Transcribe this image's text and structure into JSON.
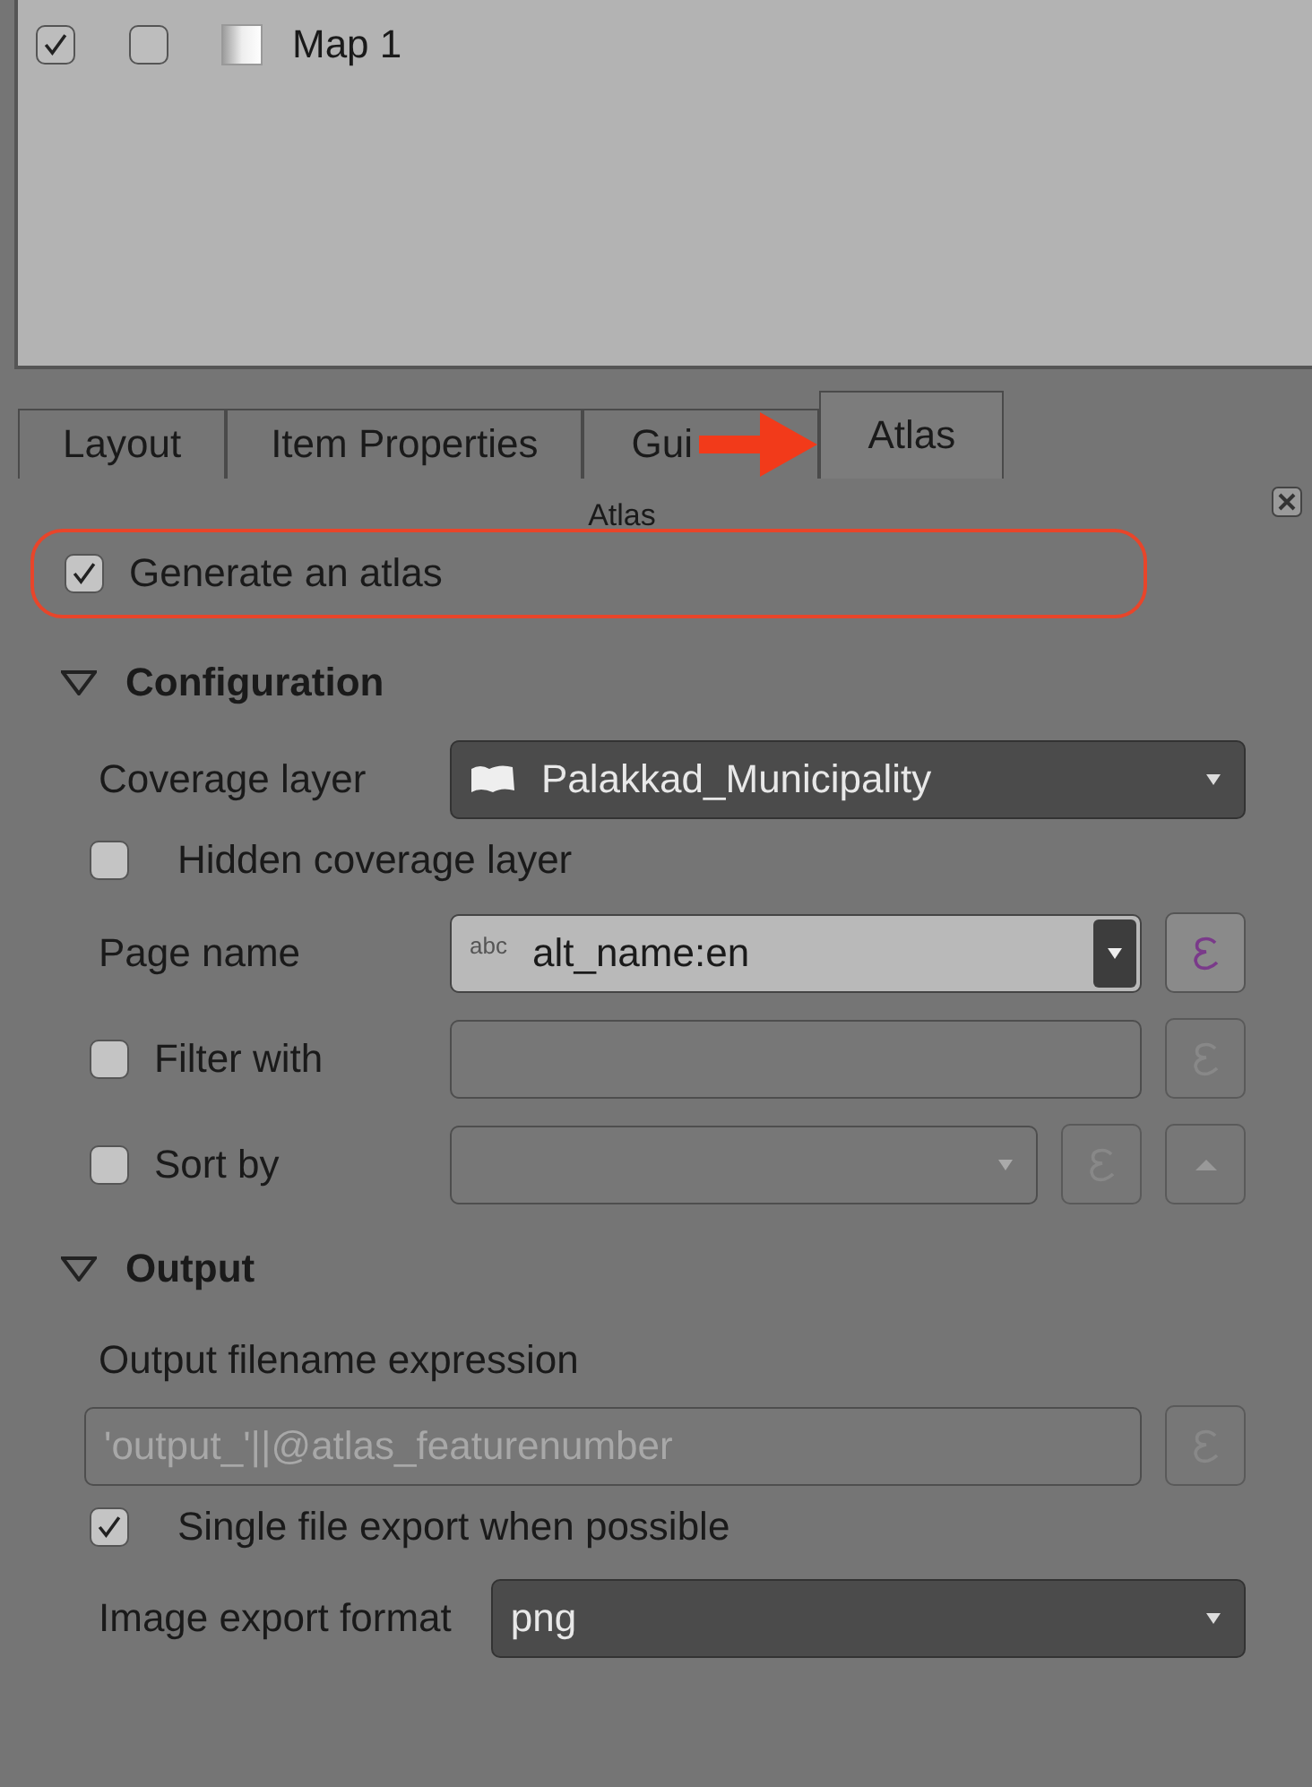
{
  "items_list": {
    "rows": [
      {
        "visible": true,
        "locked": false,
        "name": "Map 1"
      }
    ]
  },
  "tabs": [
    {
      "label": "Layout",
      "selected": false
    },
    {
      "label": "Item Properties",
      "selected": false
    },
    {
      "label": "Gui",
      "selected": false,
      "pointer_arrow": true
    },
    {
      "label": "Atlas",
      "selected": true
    }
  ],
  "panel": {
    "title": "Atlas"
  },
  "generate_atlas": {
    "label": "Generate an atlas",
    "checked": true,
    "highlighted": true
  },
  "sections": [
    {
      "title": "Configuration",
      "expanded": true,
      "rows": [
        {
          "kind": "layer-combo",
          "label": "Coverage layer",
          "value": "Palakkad_Municipality"
        },
        {
          "kind": "check",
          "label": "Hidden coverage layer",
          "checked": false
        },
        {
          "kind": "field-combo",
          "label": "Page name",
          "type_tag": "abc",
          "value": "alt_name:en",
          "expression_enabled": true
        },
        {
          "kind": "check-field",
          "label": "Filter with",
          "checked": false,
          "expression_enabled": false
        },
        {
          "kind": "check-combo",
          "label": "Sort by",
          "checked": false,
          "expression_enabled": false
        }
      ]
    },
    {
      "title": "Output",
      "expanded": true,
      "rows": [
        {
          "kind": "caption",
          "label": "Output filename expression"
        },
        {
          "kind": "expression-field",
          "value": "'output_'||@atlas_featurenumber",
          "disabled": true,
          "expression_enabled": false
        },
        {
          "kind": "check",
          "label": "Single file export when possible",
          "checked": true
        },
        {
          "kind": "combo",
          "label": "Image export format",
          "value": "png"
        }
      ]
    }
  ]
}
